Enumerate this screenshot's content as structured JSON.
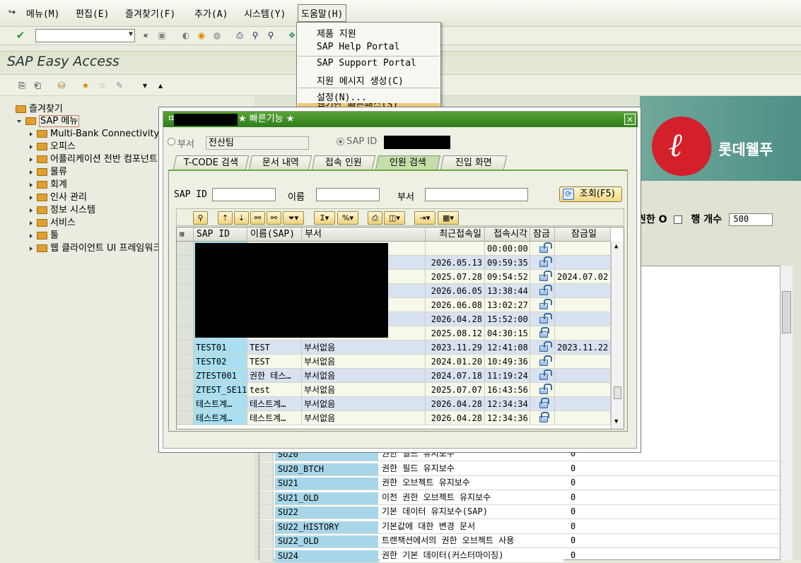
{
  "menubar": {
    "items": [
      "메뉴(M)",
      "편집(E)",
      "즐겨찾기(F)",
      "추가(A)",
      "시스템(Y)",
      "도움말(H)"
    ]
  },
  "title": "SAP Easy Access",
  "tree": {
    "favorites": "즐겨찾기",
    "sap_menu": "SAP 메뉴",
    "children": [
      "Multi-Bank Connectivity",
      "오피스",
      "어플리케이션 전반 컴포넌트",
      "물류",
      "회계",
      "인사 관리",
      "정보 시스템",
      "서비스",
      "툴",
      "웹 클라이언트 UI 프레임워크"
    ]
  },
  "help_menu": {
    "items": [
      "제품 지원",
      "SAP Help Portal",
      "SAP Support Portal",
      "지원 메시지 생성(C)",
      "설정(N)...",
      "웹기반 빠른패스(S)"
    ]
  },
  "background": {
    "logo_text": "롯데웰푸",
    "row_count_label": "행 개수",
    "row_count_value": "500",
    "auth_label": "권한 O",
    "rows": [
      {
        "code": "SU20",
        "desc": "권한 필드 유지보수",
        "num": "0"
      },
      {
        "code": "SU20_BTCH",
        "desc": "권한 필드 유지보수",
        "num": "0"
      },
      {
        "code": "SU21",
        "desc": "권한 오브젝트 유지보수",
        "num": "0"
      },
      {
        "code": "SU21_OLD",
        "desc": "이전 권한 오브젝트 유지보수",
        "num": "0"
      },
      {
        "code": "SU22",
        "desc": "기본 데이터 유지보수(SAP)",
        "num": "0"
      },
      {
        "code": "SU22_HISTORY",
        "desc": "기본값에 대한 변경 문서",
        "num": "0"
      },
      {
        "code": "SU22_OLD",
        "desc": "트랜잭션에서의 권한 오브젝트 사용",
        "num": "0"
      },
      {
        "code": "SU24",
        "desc": "권한 기본 데이터(커스터마이징)",
        "num": "0"
      }
    ]
  },
  "dialog": {
    "title": "★ 빠른기능 ★",
    "title_prefix": "ㄸ",
    "close": "×",
    "radio_dept_label": "부서",
    "dept_value": "전산팀",
    "radio_sapid_label": "SAP ID",
    "tabs": [
      "T-CODE 검색",
      "문서 내역",
      "접속 인원",
      "인원 검색",
      "진입 화면"
    ],
    "search": {
      "sapid_label": "SAP ID",
      "name_label": "이름",
      "dept_label": "부서",
      "query_button": "조회(F5)"
    },
    "columns": [
      "SAP ID",
      "이름(SAP)",
      "부서",
      "최근접속일",
      "접속시각",
      "잠금",
      "잠금일"
    ],
    "rows": [
      {
        "id": "",
        "name": "",
        "dept": "",
        "date": "",
        "time": "00:00:00",
        "lock": "open",
        "lockdate": ""
      },
      {
        "id": "",
        "name": "",
        "dept": "",
        "date": "2026.05.13",
        "time": "09:59:35",
        "lock": "open",
        "lockdate": ""
      },
      {
        "id": "",
        "name": "",
        "dept": "",
        "date": "2025.07.28",
        "time": "09:54:52",
        "lock": "open",
        "lockdate": "2024.07.02"
      },
      {
        "id": "",
        "name": "",
        "dept": "",
        "date": "2026.06.05",
        "time": "13:38:44",
        "lock": "open",
        "lockdate": ""
      },
      {
        "id": "",
        "name": "",
        "dept": "",
        "date": "2026.06.08",
        "time": "13:02:27",
        "lock": "open",
        "lockdate": ""
      },
      {
        "id": "",
        "name": "",
        "dept": "",
        "date": "2026.04.28",
        "time": "15:52:00",
        "lock": "open",
        "lockdate": ""
      },
      {
        "id": "",
        "name": "",
        "dept": "",
        "date": "2025.08.12",
        "time": "04:30:15",
        "lock": "closed",
        "lockdate": ""
      },
      {
        "id": "TEST01",
        "name": "TEST",
        "dept": "부서없음",
        "date": "2023.11.29",
        "time": "12:41:08",
        "lock": "open",
        "lockdate": "2023.11.22"
      },
      {
        "id": "TEST02",
        "name": "TEST",
        "dept": "부서없음",
        "date": "2024.01.20",
        "time": "10:49:36",
        "lock": "open",
        "lockdate": ""
      },
      {
        "id": "ZTEST001",
        "name": "권한 테스…",
        "dept": "부서없음",
        "date": "2024.07.18",
        "time": "11:19:24",
        "lock": "open",
        "lockdate": ""
      },
      {
        "id": "ZTEST_SE11",
        "name": "test",
        "dept": "부서없음",
        "date": "2025.07.07",
        "time": "16:43:56",
        "lock": "open",
        "lockdate": ""
      },
      {
        "id": "테스트계…",
        "name": "테스트계…",
        "dept": "부서없음",
        "date": "2026.04.28",
        "time": "12:34:34",
        "lock": "closed",
        "lockdate": ""
      },
      {
        "id": "테스트계…",
        "name": "테스트계…",
        "dept": "부서없음",
        "date": "2026.04.28",
        "time": "12:34:36",
        "lock": "closed",
        "lockdate": ""
      }
    ]
  }
}
